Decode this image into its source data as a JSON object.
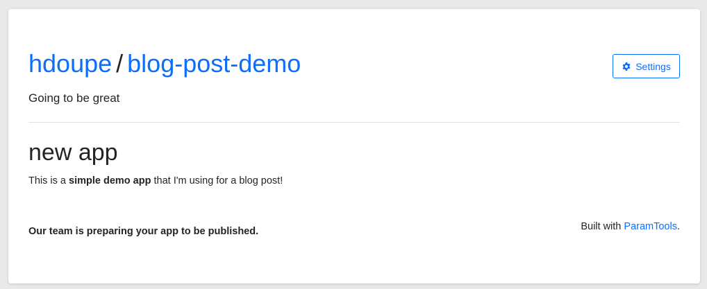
{
  "header": {
    "owner": "hdoupe",
    "separator": "/",
    "project": "blog-post-demo",
    "settings_label": "Settings",
    "settings_icon": "gear-icon",
    "tagline": "Going to be great"
  },
  "app": {
    "title": "new app",
    "description_prefix": "This is a ",
    "description_bold": "simple demo app",
    "description_suffix": " that I'm using for a blog post!"
  },
  "footer": {
    "status": "Our team is preparing your app to be published.",
    "built_with_prefix": "Built with ",
    "built_with_link": "ParamTools",
    "built_with_suffix": "."
  },
  "colors": {
    "accent": "#0d6efd",
    "text": "#212529",
    "divider": "#dee2e6",
    "background": "#e9e9e9",
    "card": "#ffffff"
  }
}
